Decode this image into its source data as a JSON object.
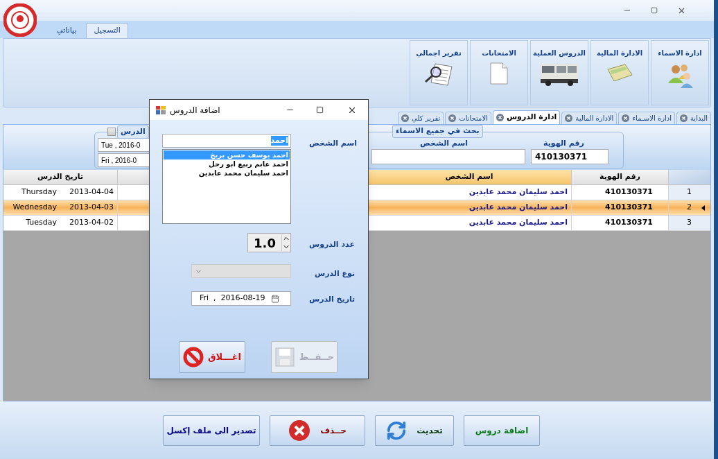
{
  "ribbon_tabs": [
    {
      "label": "التسجيل",
      "selected": true
    },
    {
      "label": "بياناتي",
      "selected": false
    }
  ],
  "ribbon_buttons": [
    {
      "label": "ادارة الاسماء",
      "kind": "people"
    },
    {
      "label": "الادارة المالية",
      "kind": "money"
    },
    {
      "label": "الدروس العملية",
      "kind": "truck"
    },
    {
      "label": "الامتحانات",
      "kind": "document"
    },
    {
      "label": "تقرير اجمالي",
      "kind": "report"
    }
  ],
  "document_tabs": [
    {
      "label": "البداية",
      "selected": false
    },
    {
      "label": "ادارة الاسـماء",
      "selected": false
    },
    {
      "label": "الادارة المالية",
      "selected": false
    },
    {
      "label": "ادارة الدروس",
      "selected": true
    },
    {
      "label": "الامتحانات",
      "selected": false
    },
    {
      "label": "تقرير كلي",
      "selected": false
    }
  ],
  "search": {
    "group_title": "بحث في جميع الاسماء",
    "id_label": "رقم الهوية",
    "id_value": "410130371",
    "name_label": "اسم الشخص"
  },
  "date_filter": {
    "title": "الدرس",
    "checked": false,
    "from": "Tue , 2016-0",
    "to": "Fri , 2016-0"
  },
  "table": {
    "columns": [
      {
        "label": "رقم الهوية",
        "selected": false
      },
      {
        "label": "اسم الشخص",
        "selected": true
      },
      {
        "label": "تاريخ الدرس",
        "selected": false
      }
    ],
    "rows": [
      {
        "number": "1",
        "id": "410130371",
        "name": "احمد سليمان محمد عابدين",
        "date": "2013-04-04",
        "day": "Thursday",
        "selected": false
      },
      {
        "number": "2",
        "id": "410130371",
        "name": "احمد سليمان محمد عابدين",
        "date": "2013-04-03",
        "day": "Wednesday",
        "selected": true
      },
      {
        "number": "3",
        "id": "410130371",
        "name": "احمد سليمان محمد عابدين",
        "date": "2013-04-02",
        "day": "Tuesday",
        "selected": false
      }
    ]
  },
  "actions": [
    {
      "label": "اضافة دروس",
      "kind": "add"
    },
    {
      "label": "تحديث",
      "kind": "refresh"
    },
    {
      "label": "حــذف",
      "kind": "delete"
    },
    {
      "label": "تصدير الى ملف إكسل",
      "kind": "export"
    }
  ],
  "dialog": {
    "title": "اضافة الدروس",
    "person_label": "اسم الشخص",
    "person_value": "احمد",
    "suggestions": [
      {
        "label": "احمد يوسف حسن بريخ",
        "selected": true
      },
      {
        "label": "احمد غانم ربيع ابو رحل",
        "selected": false
      },
      {
        "label": "احمد سليمان محمد عابدين",
        "selected": false
      }
    ],
    "count_label": "عدد الدروس",
    "count_value": "1.0",
    "type_label": "نوع الدرس",
    "date_label": "تاريخ الدرس",
    "date_value": "Fri  ,  2016-08-19",
    "buttons": [
      {
        "label": "حــفــظ",
        "kind": "save",
        "disabled": true
      },
      {
        "label": "اغـــلاق",
        "kind": "close",
        "disabled": false
      }
    ]
  }
}
